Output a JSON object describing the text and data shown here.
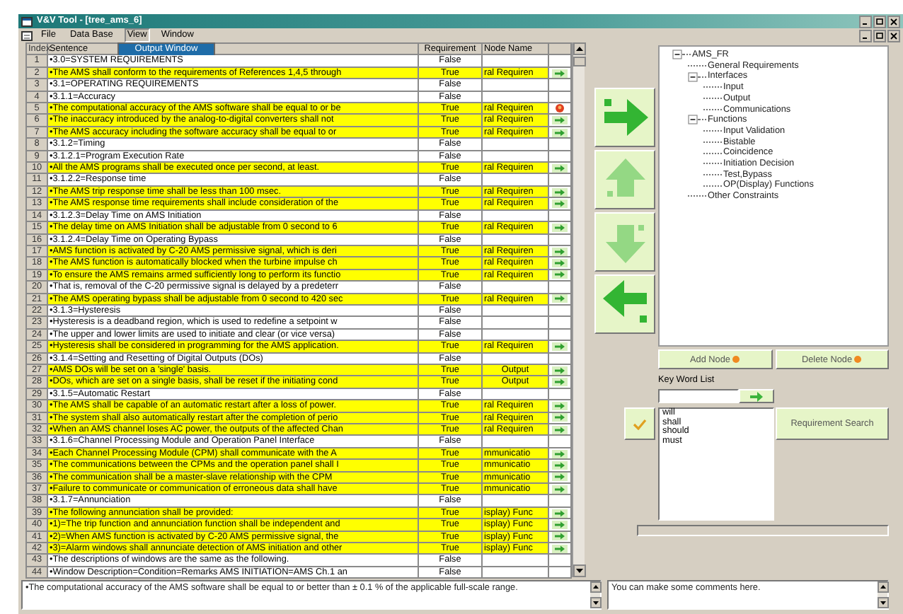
{
  "window": {
    "title": "V&V Tool - [tree_ams_6]"
  },
  "menu": [
    {
      "label": "File",
      "open": false
    },
    {
      "label": "Data Base",
      "open": false
    },
    {
      "label": "View",
      "open": true
    },
    {
      "label": "Window",
      "open": false
    }
  ],
  "open_menu": {
    "items": [
      "Output Window"
    ]
  },
  "table": {
    "columns": [
      "Index",
      "Sentence",
      "Requirement",
      "Node Name"
    ],
    "rows": [
      {
        "index": "1",
        "sentence": "•3.0=SYSTEM REQUIREMENTS",
        "requirement": "False",
        "highlighted": false
      },
      {
        "index": "2",
        "sentence": "•The AMS shall conform to the requirements of References 1,4,5 through",
        "requirement": "True",
        "highlighted": true,
        "node_name": "ral Requiren",
        "marker": {
          "kind": "go"
        }
      },
      {
        "index": "3",
        "sentence": "•3.1=OPERATING REQUIREMENTS",
        "requirement": "False",
        "highlighted": false
      },
      {
        "index": "4",
        "sentence": "•3.1.1=Accuracy",
        "requirement": "False",
        "highlighted": false
      },
      {
        "index": "5",
        "sentence": "•The computational accuracy of the AMS software shall be equal to or be",
        "requirement": "True",
        "highlighted": true,
        "node_name": "ral Requiren",
        "marker": {
          "kind": "alert"
        }
      },
      {
        "index": "6",
        "sentence": "•The inaccuracy introduced by the analog-to-digital converters shall not",
        "requirement": "True",
        "highlighted": true,
        "node_name": "ral Requiren",
        "marker": {
          "kind": "go"
        }
      },
      {
        "index": "7",
        "sentence": "•The AMS accuracy including the software accuracy shall be equal to or",
        "requirement": "True",
        "highlighted": true,
        "node_name": "ral Requiren",
        "marker": {
          "kind": "go"
        }
      },
      {
        "index": "8",
        "sentence": "•3.1.2=Timing",
        "requirement": "False",
        "highlighted": false
      },
      {
        "index": "9",
        "sentence": "•3.1.2.1=Program Execution Rate",
        "requirement": "False",
        "highlighted": false
      },
      {
        "index": "10",
        "sentence": "•All the AMS programs shall be executed once per second, at least.",
        "requirement": "True",
        "highlighted": true,
        "node_name": "ral Requiren",
        "marker": {
          "kind": "go"
        }
      },
      {
        "index": "11",
        "sentence": "•3.1.2.2=Response time",
        "requirement": "False",
        "highlighted": false
      },
      {
        "index": "12",
        "sentence": "•The AMS trip response time shall be less than 100 msec.",
        "requirement": "True",
        "highlighted": true,
        "node_name": "ral Requiren",
        "marker": {
          "kind": "go"
        }
      },
      {
        "index": "13",
        "sentence": "•The AMS response time requirements shall include consideration of the",
        "requirement": "True",
        "highlighted": true,
        "node_name": "ral Requiren",
        "marker": {
          "kind": "go"
        }
      },
      {
        "index": "14",
        "sentence": "•3.1.2.3=Delay Time on AMS Initiation",
        "requirement": "False",
        "highlighted": false
      },
      {
        "index": "15",
        "sentence": "•The delay time on AMS Initiation shall be adjustable from 0 second to 6",
        "requirement": "True",
        "highlighted": true,
        "node_name": "ral Requiren",
        "marker": {
          "kind": "go"
        }
      },
      {
        "index": "16",
        "sentence": "•3.1.2.4=Delay Time on Operating Bypass",
        "requirement": "False",
        "highlighted": false
      },
      {
        "index": "17",
        "sentence": "•AMS function is activated by C-20 AMS permissive signal, which is deri",
        "requirement": "True",
        "highlighted": true,
        "node_name": "ral Requiren",
        "marker": {
          "kind": "go"
        }
      },
      {
        "index": "18",
        "sentence": "•The AMS function is automatically blocked when the turbine impulse ch",
        "requirement": "True",
        "highlighted": true,
        "node_name": "ral Requiren",
        "marker": {
          "kind": "go"
        }
      },
      {
        "index": "19",
        "sentence": "•To ensure the AMS remains armed sufficiently long to perform its functio",
        "requirement": "True",
        "highlighted": true,
        "node_name": "ral Requiren",
        "marker": {
          "kind": "go"
        }
      },
      {
        "index": "20",
        "sentence": "•That is, removal of the C-20 permissive signal is delayed by a predeterr",
        "requirement": "False",
        "highlighted": false
      },
      {
        "index": "21",
        "sentence": "•The AMS operating bypass shall be adjustable from 0 second to 420 sec",
        "requirement": "True",
        "highlighted": true,
        "node_name": "ral Requiren",
        "marker": {
          "kind": "go"
        }
      },
      {
        "index": "22",
        "sentence": "•3.1.3=Hysteresis",
        "requirement": "False",
        "highlighted": false
      },
      {
        "index": "23",
        "sentence": "•Hysteresis is a deadband region, which is used to redefine a setpoint w",
        "requirement": "False",
        "highlighted": false
      },
      {
        "index": "24",
        "sentence": "•The upper and lower limits are used to initiate and clear (or vice versa)",
        "requirement": "False",
        "highlighted": false
      },
      {
        "index": "25",
        "sentence": "•Hysteresis shall be considered in programming for the AMS application.",
        "requirement": "True",
        "highlighted": true,
        "node_name": "ral Requiren",
        "marker": {
          "kind": "go"
        }
      },
      {
        "index": "26",
        "sentence": "•3.1.4=Setting and Resetting of Digital Outputs (DOs)",
        "requirement": "False",
        "highlighted": false
      },
      {
        "index": "27",
        "sentence": "•AMS DOs will be set on a 'single' basis.",
        "requirement": "True",
        "highlighted": true,
        "node_name": "Output",
        "marker": {
          "kind": "go"
        }
      },
      {
        "index": "28",
        "sentence": "•DOs, which are set on a single basis, shall be reset if the initiating cond",
        "requirement": "True",
        "highlighted": true,
        "node_name": "Output",
        "marker": {
          "kind": "go"
        }
      },
      {
        "index": "29",
        "sentence": "•3.1.5=Automatic Restart",
        "requirement": "False",
        "highlighted": false
      },
      {
        "index": "30",
        "sentence": "•The AMS shall be capable of an automatic restart after a loss of power.",
        "requirement": "True",
        "highlighted": true,
        "node_name": "ral Requiren",
        "marker": {
          "kind": "go"
        }
      },
      {
        "index": "31",
        "sentence": "•The system shall also automatically restart after the completion of perio",
        "requirement": "True",
        "highlighted": true,
        "node_name": "ral Requiren",
        "marker": {
          "kind": "go"
        }
      },
      {
        "index": "32",
        "sentence": "•When an AMS channel loses AC power, the outputs of the affected Chan",
        "requirement": "True",
        "highlighted": true,
        "node_name": "ral Requiren",
        "marker": {
          "kind": "go"
        }
      },
      {
        "index": "33",
        "sentence": "•3.1.6=Channel Processing Module and Operation Panel Interface",
        "requirement": "False",
        "highlighted": false
      },
      {
        "index": "34",
        "sentence": "•Each Channel Processing Module (CPM) shall communicate with the A",
        "requirement": "True",
        "highlighted": true,
        "node_name": "mmunicatio",
        "marker": {
          "kind": "go"
        }
      },
      {
        "index": "35",
        "sentence": "•The communications between the CPMs and the operation panel shall I",
        "requirement": "True",
        "highlighted": true,
        "node_name": "mmunicatio",
        "marker": {
          "kind": "go"
        }
      },
      {
        "index": "36",
        "sentence": "•The communication shall be a master-slave relationship with the CPM",
        "requirement": "True",
        "highlighted": true,
        "node_name": "mmunicatio",
        "marker": {
          "kind": "go"
        }
      },
      {
        "index": "37",
        "sentence": "•Failure to communicate or communication of erroneous data shall have",
        "requirement": "True",
        "highlighted": true,
        "node_name": "mmunicatio",
        "marker": {
          "kind": "go"
        }
      },
      {
        "index": "38",
        "sentence": "•3.1.7=Annunciation",
        "requirement": "False",
        "highlighted": false
      },
      {
        "index": "39",
        "sentence": "•The following annunciation shall be provided:",
        "requirement": "True",
        "highlighted": true,
        "node_name": "isplay) Func",
        "marker": {
          "kind": "go"
        }
      },
      {
        "index": "40",
        "sentence": "•1)=The trip function and annunciation function shall be independent and",
        "requirement": "True",
        "highlighted": true,
        "node_name": "isplay) Func",
        "marker": {
          "kind": "go"
        }
      },
      {
        "index": "41",
        "sentence": "•2)=When AMS function is activated by C-20 AMS permissive signal, the",
        "requirement": "True",
        "highlighted": true,
        "node_name": "isplay) Func",
        "marker": {
          "kind": "go"
        }
      },
      {
        "index": "42",
        "sentence": "•3)=Alarm windows shall annunciate detection of AMS initiation and other",
        "requirement": "True",
        "highlighted": true,
        "node_name": "isplay) Func",
        "marker": {
          "kind": "go"
        }
      },
      {
        "index": "43",
        "sentence": "•The descriptions of windows are the same as the following.",
        "requirement": "False",
        "highlighted": false
      },
      {
        "index": "44",
        "sentence": "•Window Description=Condition=Remarks  AMS INITIATION=AMS Ch.1 an",
        "requirement": "False",
        "highlighted": false
      }
    ]
  },
  "move_buttons": [
    {
      "kind": "right",
      "disabled": false
    },
    {
      "kind": "up",
      "disabled": true
    },
    {
      "kind": "down",
      "disabled": true
    },
    {
      "kind": "left",
      "disabled": false
    }
  ],
  "tree": {
    "label": "AMS_FR",
    "expanded": true,
    "children": [
      {
        "label": "General Requirements"
      },
      {
        "label": "Interfaces",
        "expanded": true,
        "children": [
          {
            "label": "Input"
          },
          {
            "label": "Output"
          },
          {
            "label": "Communications"
          }
        ]
      },
      {
        "label": "Functions",
        "expanded": true,
        "children": [
          {
            "label": "Input Validation"
          },
          {
            "label": "Bistable"
          },
          {
            "label": "Coincidence"
          },
          {
            "label": "Initiation Decision"
          },
          {
            "label": "Test,Bypass"
          },
          {
            "label": "OP(Display) Functions"
          }
        ]
      },
      {
        "label": "Other Constraints"
      }
    ]
  },
  "node_buttons": [
    "Add Node",
    "Delete Node"
  ],
  "keywords": {
    "label": "Key Word List",
    "items": [
      "will",
      "shall",
      "should",
      "must"
    ]
  },
  "search_button": "Requirement Search",
  "progress": {
    "level": 0
  },
  "detail_text": "•The computational accuracy of the AMS software shall be equal to or better than ± 0.1 % of the applicable full-scale range.",
  "comments": "You can make some comments here."
}
